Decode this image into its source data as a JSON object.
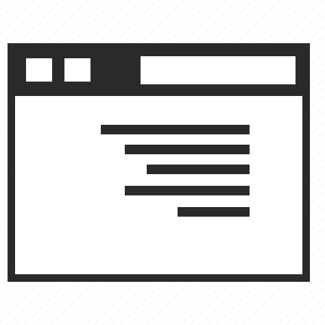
{
  "icon": {
    "name": "browser-window-right-aligned-text-icon",
    "colors": {
      "stroke": "#2a2a2a",
      "fill": "#ffffff"
    },
    "text_line_count": 5
  }
}
